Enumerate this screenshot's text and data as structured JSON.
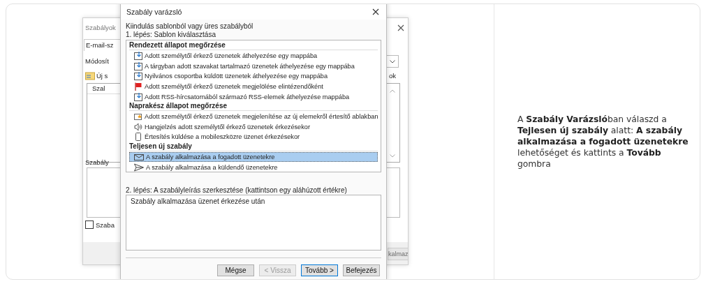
{
  "background_window": {
    "title": "Szabályok",
    "tab": "E-mail-sz",
    "label": "Módosít",
    "toolbar_button": "Új s",
    "list_column": "Szal",
    "right_label": "ok",
    "section_label": "Szabály",
    "checkbox": {
      "label": "Szaba",
      "checked": false
    },
    "button": "kalmaz"
  },
  "dialog": {
    "title": "Szabály varázsló",
    "heading": "Kiindulás sablonból vagy üres szabályból",
    "step1": "1. lépés: Sablon kiválasztása",
    "groups": [
      {
        "title": "Rendezett állapot megőrzése",
        "items": [
          {
            "kind": "move",
            "label": "Adott személytől érkező üzenetek áthelyezése egy mappába",
            "selected": false
          },
          {
            "kind": "move",
            "label": "A tárgyban adott szavakat tartalmazó üzenetek áthelyezése egy mappába",
            "selected": false
          },
          {
            "kind": "move",
            "label": "Nyilvános csoportba küldött üzenetek áthelyezése egy mappába",
            "selected": false
          },
          {
            "kind": "flag",
            "label": "Adott személytől érkező üzenetek megjelölése elintézendőként",
            "selected": false
          },
          {
            "kind": "move",
            "label": "Adott RSS-hírcsatornából származó RSS-elemek áthelyezése mappába",
            "selected": false
          }
        ]
      },
      {
        "title": "Naprakész állapot megőrzése",
        "items": [
          {
            "kind": "alert",
            "label": "Adott személytől érkező üzenetek megjelenítése az új elemekről értesítő ablakban",
            "selected": false
          },
          {
            "kind": "sound",
            "label": "Hangjelzés adott személytől érkező üzenetek érkezésekor",
            "selected": false
          },
          {
            "kind": "mobile",
            "label": "Értesítés küldése a mobileszközre üzenet érkezésekor",
            "selected": false
          }
        ]
      },
      {
        "title": "Teljesen új szabály",
        "items": [
          {
            "kind": "mail",
            "label": "A szabály alkalmazása a fogadott üzenetekre",
            "selected": true
          },
          {
            "kind": "send",
            "label": "A szabály alkalmazása a küldendő üzenetekre",
            "selected": false
          }
        ]
      }
    ],
    "step2": "2. lépés: A szabályleírás szerkesztése (kattintson egy aláhúzott értékre)",
    "description": "Szabály alkalmazása üzenet érkezése után",
    "buttons": [
      {
        "label": "Mégse",
        "disabled": false,
        "default": false
      },
      {
        "label": "< Vissza",
        "disabled": true,
        "default": false
      },
      {
        "label": "Tovább >",
        "disabled": false,
        "default": true
      },
      {
        "label": "Befejezés",
        "disabled": false,
        "default": false
      }
    ]
  },
  "instruction": "A **Szabály Varázsló**ban válaszd a **Tejlesen új szabály** alatt: **A szabály alkalmazása a fogadott üzenetekre** lehetőséget és kattints a **Tovább** gombra"
}
